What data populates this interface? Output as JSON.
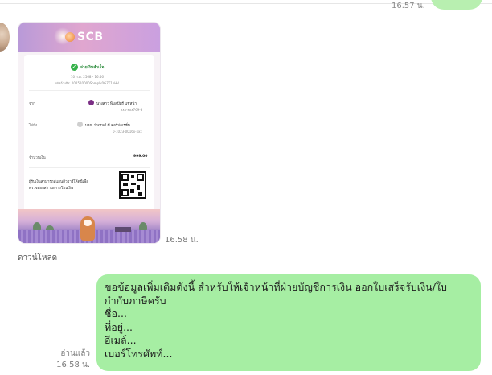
{
  "top": {
    "time": "16.57 น."
  },
  "receipt_image": {
    "bank_logo_text": "SCB",
    "status": "จ่ายเงินสำเร็จ",
    "date_line": "10 ก.ค. 2568 - 16:56",
    "ref_line": "รหัสอ้างอิง: 202510000Somplk0G7T1bHV",
    "from_label": "จาก",
    "from_name": "นางสาว พิมลปัทร์ แช่หน่า",
    "from_acct": "xxx-xxx769-3",
    "to_label": "ไปยัง",
    "to_name": "บจก. นันทนต์ ซี คอร์ปอเรชั่น",
    "to_acct": "0-1023-0016x-xxx",
    "amount_label": "จำนวนเงิน",
    "amount_value": "999.00",
    "qr_note_1": "ผู้รับเงินสามารถสแกนคิวอาร์โค้ดนี้เพื่อ",
    "qr_note_2": "ตรวจสอบสถานะการโอนเงิน",
    "colors": {
      "success": "#35b24a",
      "header_gradient_start": "#b99ad8",
      "header_gradient_end": "#caa0e0"
    }
  },
  "image_time": "16.58 น.",
  "download_label": "ดาวน์โหลด",
  "message": {
    "lines": [
      "ขอข้อมูลเพิ่มเติมดังนี้ สำหรับให้เจ้าหน้าที่ฝ่ายบัญชีการเงิน ออกใบเสร็จรับเงิน/ใบ",
      "กำกับภาษีครับ",
      "ชื่อ...",
      "ที่อยู่...",
      "อีเมล์...",
      "เบอร์โทรศัพท์..."
    ],
    "bubble_color": "#a6eea3"
  },
  "read_status": {
    "label": "อ่านแล้ว",
    "time": "16.58 น."
  }
}
